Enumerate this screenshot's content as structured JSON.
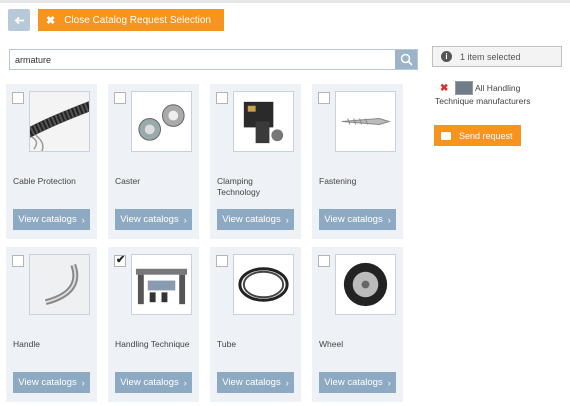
{
  "toolbar": {
    "close_label": "Close Catalog Request Selection"
  },
  "search": {
    "value": "armature"
  },
  "cards": [
    {
      "label": "Cable Protection",
      "button": "View catalogs",
      "checked": false
    },
    {
      "label": "Caster",
      "button": "View catalogs",
      "checked": false
    },
    {
      "label": "Clamping Technology",
      "button": "View catalogs",
      "checked": false
    },
    {
      "label": "Fastening",
      "button": "View catalogs",
      "checked": false
    },
    {
      "label": "Handle",
      "button": "View catalogs",
      "checked": false
    },
    {
      "label": "Handling Technique",
      "button": "View catalogs",
      "checked": true
    },
    {
      "label": "Tube",
      "button": "View catalogs",
      "checked": false
    },
    {
      "label": "Wheel",
      "button": "View catalogs",
      "checked": false
    }
  ],
  "selection": {
    "summary": "1 item selected",
    "items": [
      {
        "label": "All Handling Technique manufacturers"
      }
    ],
    "send_label": "Send request"
  },
  "colors": {
    "accent": "#f7941d",
    "view_button": "#8eaac3",
    "card_bg": "#eef1f5",
    "remove": "#d9302c"
  }
}
